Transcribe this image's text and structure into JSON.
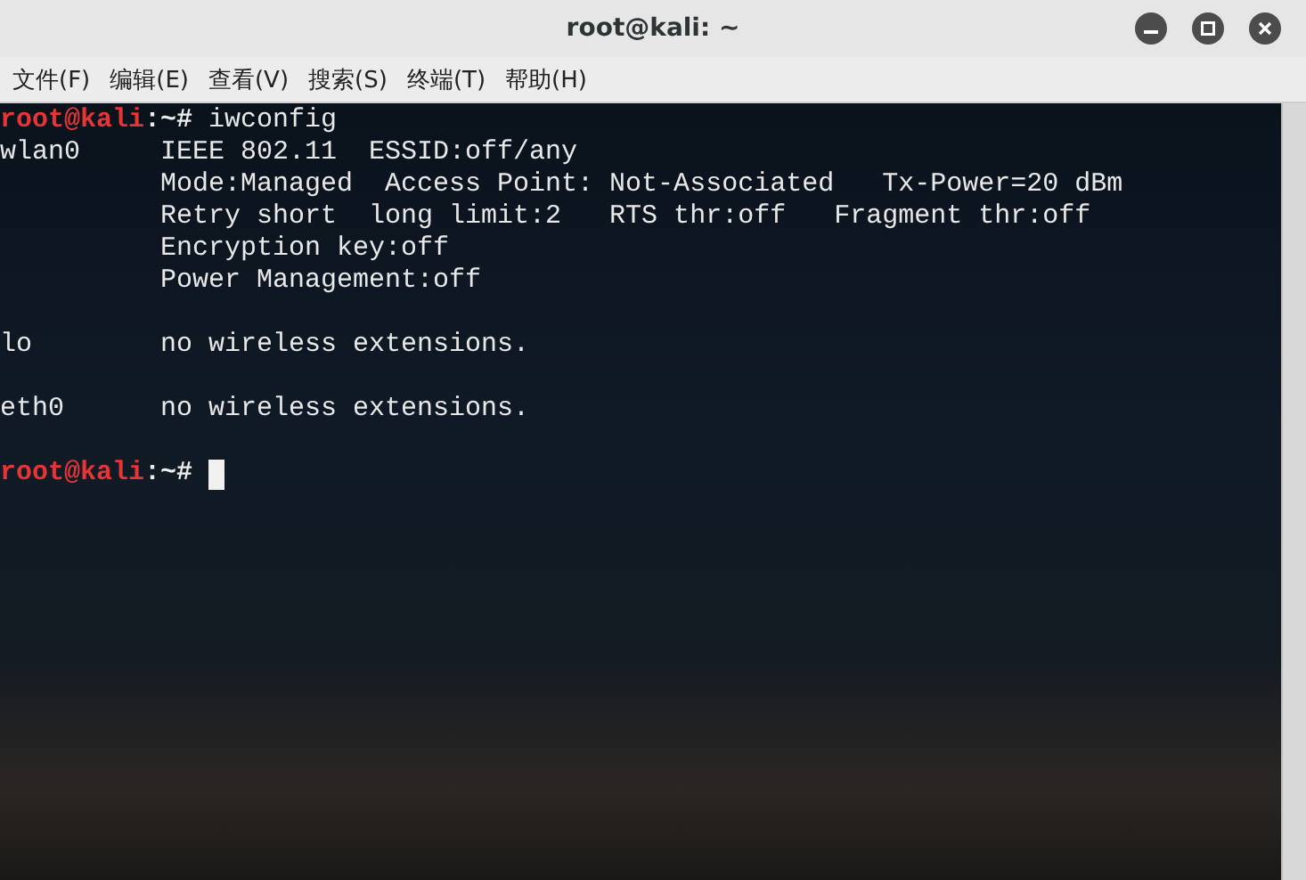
{
  "window": {
    "title": "root@kali: ~"
  },
  "menu": [
    "文件(F)",
    "编辑(E)",
    "查看(V)",
    "搜索(S)",
    "终端(T)",
    "帮助(H)"
  ],
  "terminal": {
    "lines": [
      {
        "kind": "prompt",
        "user": "root@kali",
        "path": ":~#",
        "command": "iwconfig",
        "cursor": false
      },
      {
        "kind": "output",
        "text": "wlan0     IEEE 802.11  ESSID:off/any"
      },
      {
        "kind": "output",
        "text": "          Mode:Managed  Access Point: Not-Associated   Tx-Power=20 dBm"
      },
      {
        "kind": "output",
        "text": "          Retry short  long limit:2   RTS thr:off   Fragment thr:off"
      },
      {
        "kind": "output",
        "text": "          Encryption key:off"
      },
      {
        "kind": "output",
        "text": "          Power Management:off"
      },
      {
        "kind": "blank"
      },
      {
        "kind": "output",
        "text": "lo        no wireless extensions."
      },
      {
        "kind": "blank"
      },
      {
        "kind": "output",
        "text": "eth0      no wireless extensions."
      },
      {
        "kind": "blank"
      },
      {
        "kind": "prompt",
        "user": "root@kali",
        "path": ":~#",
        "cursor": true
      }
    ]
  }
}
